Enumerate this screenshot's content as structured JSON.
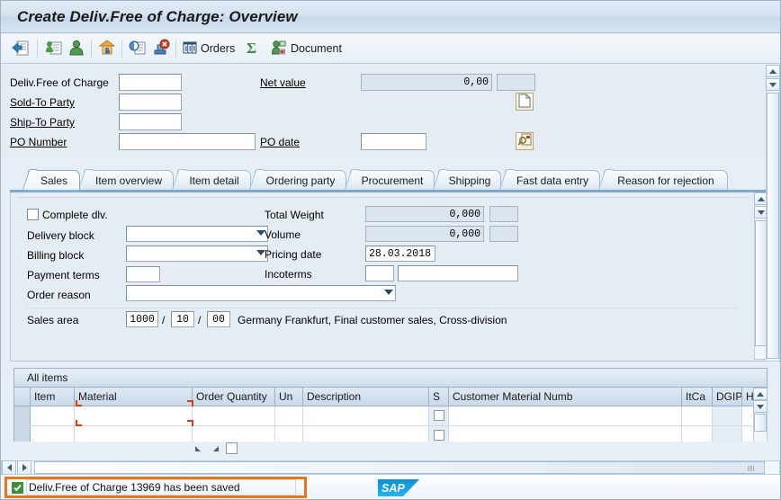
{
  "window": {
    "title": "Create Deliv.Free of Charge: Overview"
  },
  "toolbar": {
    "items": [
      {
        "name": "back-icon",
        "label": ""
      },
      {
        "name": "create-with-reference-icon",
        "label": ""
      },
      {
        "name": "partner-icon",
        "label": ""
      },
      {
        "name": "shipping-icon",
        "label": ""
      },
      {
        "name": "copy-icon",
        "label": ""
      },
      {
        "name": "reject-icon",
        "label": ""
      },
      {
        "name": "orders-icon",
        "label": "Orders"
      },
      {
        "name": "sum-icon",
        "label": ""
      },
      {
        "name": "document-icon",
        "label": "Document"
      }
    ],
    "orders_label": "Orders",
    "document_label": "Document"
  },
  "header_fields": {
    "deliv_free_of_charge": {
      "label": "Deliv.Free of Charge",
      "value": ""
    },
    "sold_to_party": {
      "label": "Sold-To Party",
      "value": ""
    },
    "ship_to_party": {
      "label": "Ship-To Party",
      "value": ""
    },
    "po_number": {
      "label": "PO Number",
      "value": ""
    },
    "net_value": {
      "label": "Net value",
      "value": "0,00",
      "currency": ""
    },
    "po_date": {
      "label": "PO date",
      "value": ""
    },
    "doc_button": "document-page-icon",
    "search_button": "search-document-icon"
  },
  "tabs": [
    {
      "label": "Sales",
      "active": true
    },
    {
      "label": "Item overview",
      "active": false
    },
    {
      "label": "Item detail",
      "active": false
    },
    {
      "label": "Ordering party",
      "active": false
    },
    {
      "label": "Procurement",
      "active": false
    },
    {
      "label": "Shipping",
      "active": false
    },
    {
      "label": "Fast data entry",
      "active": false
    },
    {
      "label": "Reason for rejection",
      "active": false
    }
  ],
  "sales_tab": {
    "complete_dlv": {
      "label": "Complete dlv.",
      "checked": false
    },
    "delivery_block": {
      "label": "Delivery block",
      "value": ""
    },
    "billing_block": {
      "label": "Billing block",
      "value": ""
    },
    "payment_terms": {
      "label": "Payment terms",
      "value": ""
    },
    "order_reason": {
      "label": "Order reason",
      "value": ""
    },
    "total_weight": {
      "label": "Total Weight",
      "value": "0,000",
      "unit": ""
    },
    "volume": {
      "label": "Volume",
      "value": "0,000",
      "unit": ""
    },
    "pricing_date": {
      "label": "Pricing date",
      "value": "28.03.2018"
    },
    "incoterms": {
      "label": "Incoterms",
      "value": "",
      "value2": ""
    },
    "sales_area": {
      "label": "Sales area",
      "org": "1000",
      "channel": "10",
      "division": "00",
      "separator": "/",
      "description": "Germany Frankfurt, Final customer sales, Cross-division"
    }
  },
  "items_table": {
    "title": "All items",
    "columns": [
      {
        "key": "sel",
        "label": ""
      },
      {
        "key": "item",
        "label": "Item"
      },
      {
        "key": "material",
        "label": "Material"
      },
      {
        "key": "order_quantity",
        "label": "Order Quantity"
      },
      {
        "key": "un",
        "label": "Un"
      },
      {
        "key": "description",
        "label": "Description"
      },
      {
        "key": "s",
        "label": "S"
      },
      {
        "key": "customer_material_numb",
        "label": "Customer Material Numb"
      },
      {
        "key": "itca",
        "label": "ItCa"
      },
      {
        "key": "dgip",
        "label": "DGIP"
      },
      {
        "key": "hl_itn",
        "label": "HL Itn"
      }
    ],
    "rows": [
      {
        "sel": "",
        "item": "",
        "material": "",
        "order_quantity": "",
        "un": "",
        "description": "",
        "s": "",
        "customer_material_numb": "",
        "itca": "",
        "dgip": "",
        "hl_itn": ""
      },
      {
        "sel": "",
        "item": "",
        "material": "",
        "order_quantity": "",
        "un": "",
        "description": "",
        "s": "",
        "customer_material_numb": "",
        "itca": "",
        "dgip": "",
        "hl_itn": ""
      }
    ]
  },
  "statusbar": {
    "message": "Deliv.Free of Charge 13969 has been saved",
    "icon": "success-check-icon",
    "logo": "SAP"
  },
  "colors": {
    "accent": "#7fa8cd",
    "highlight": "#e8761a",
    "success": "#3f8f3f",
    "required": "#e03a10",
    "sap_blue": "#1a9bdc"
  }
}
